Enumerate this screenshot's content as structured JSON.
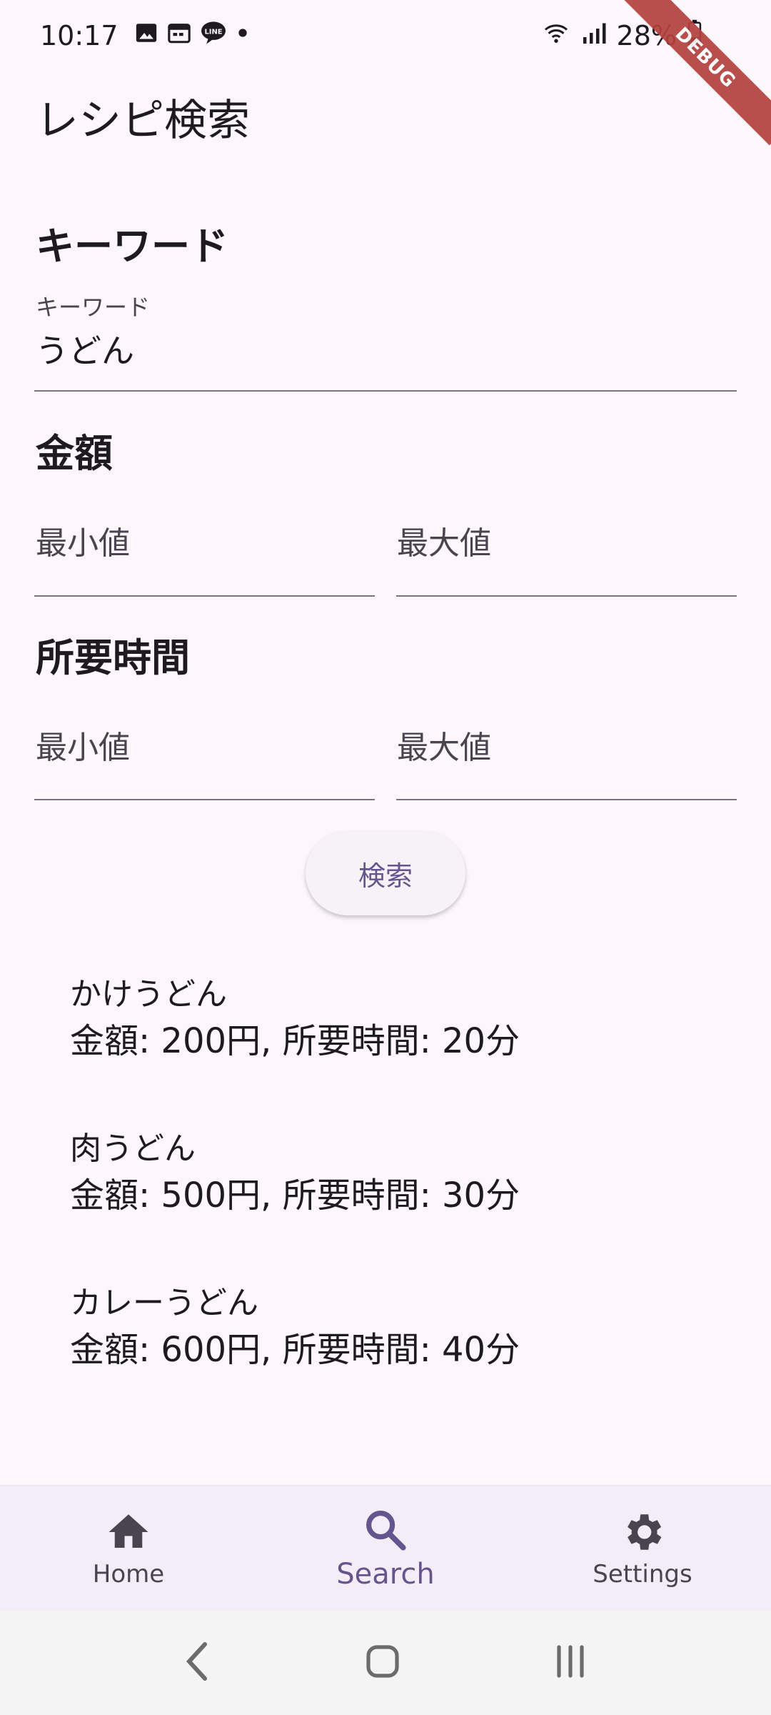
{
  "status_bar": {
    "time": "10:17",
    "battery": "28%",
    "left_icons": [
      "gallery-icon",
      "calendar-icon",
      "line-icon",
      "dot-icon"
    ],
    "right_icons": [
      "wifi-icon",
      "signal-icon",
      "battery-icon"
    ]
  },
  "debug_banner": "DEBUG",
  "app_title": "レシピ検索",
  "keyword_section": {
    "heading": "キーワード",
    "field_label": "キーワード",
    "field_value": "うどん"
  },
  "price_section": {
    "heading": "金額",
    "min_placeholder": "最小値",
    "max_placeholder": "最大値"
  },
  "time_section": {
    "heading": "所要時間",
    "min_placeholder": "最小値",
    "max_placeholder": "最大値"
  },
  "search_button_label": "検索",
  "results": [
    {
      "name": "かけうどん",
      "detail": "金額: 200円, 所要時間: 20分"
    },
    {
      "name": "肉うどん",
      "detail": "金額: 500円, 所要時間: 30分"
    },
    {
      "name": "カレーうどん",
      "detail": "金額: 600円, 所要時間: 40分"
    }
  ],
  "bottom_nav": {
    "home": {
      "label": "Home",
      "icon": "home-icon"
    },
    "search": {
      "label": "Search",
      "icon": "search-icon"
    },
    "settings": {
      "label": "Settings",
      "icon": "gear-icon"
    }
  },
  "colors": {
    "background": "#fdf7fc",
    "accent": "#65558f",
    "debug_ribbon": "#b3413f"
  }
}
